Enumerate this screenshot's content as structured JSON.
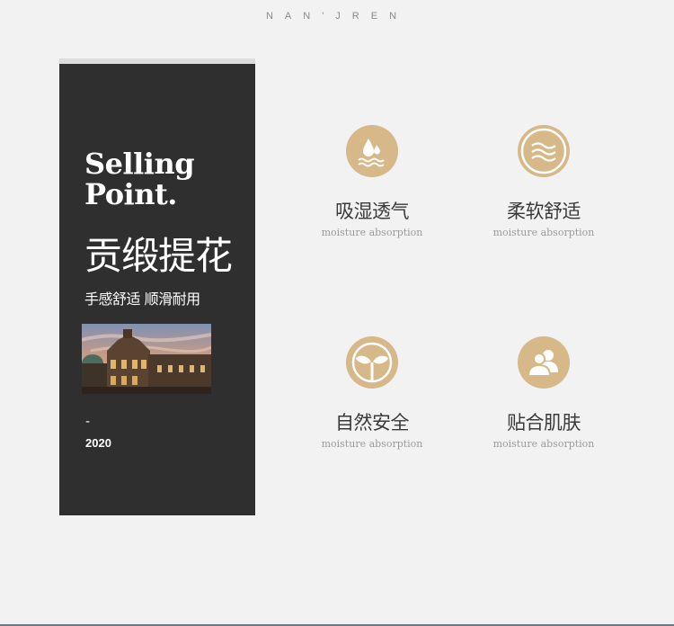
{
  "brand": "NAN'JREN",
  "card": {
    "heading_line1": "Selling",
    "heading_line2": "Point.",
    "title_cn": "贡缎提花",
    "subtitle_cn": "手感舒适 顺滑耐用",
    "dash": "-",
    "year": "2020",
    "photo": "building-photo"
  },
  "features": [
    {
      "icon": "water-drop-icon",
      "label": "吸湿透气",
      "sub": "moisture absorption"
    },
    {
      "icon": "soft-waves-icon",
      "label": "柔软舒适",
      "sub": "moisture absorption"
    },
    {
      "icon": "leaf-sprout-icon",
      "label": "自然安全",
      "sub": "moisture absorption"
    },
    {
      "icon": "people-icon",
      "label": "贴合肌肤",
      "sub": "moisture absorption"
    }
  ],
  "colors": {
    "accent": "#d6b889",
    "card": "#2f2f2f",
    "background": "#f3f2f2"
  }
}
